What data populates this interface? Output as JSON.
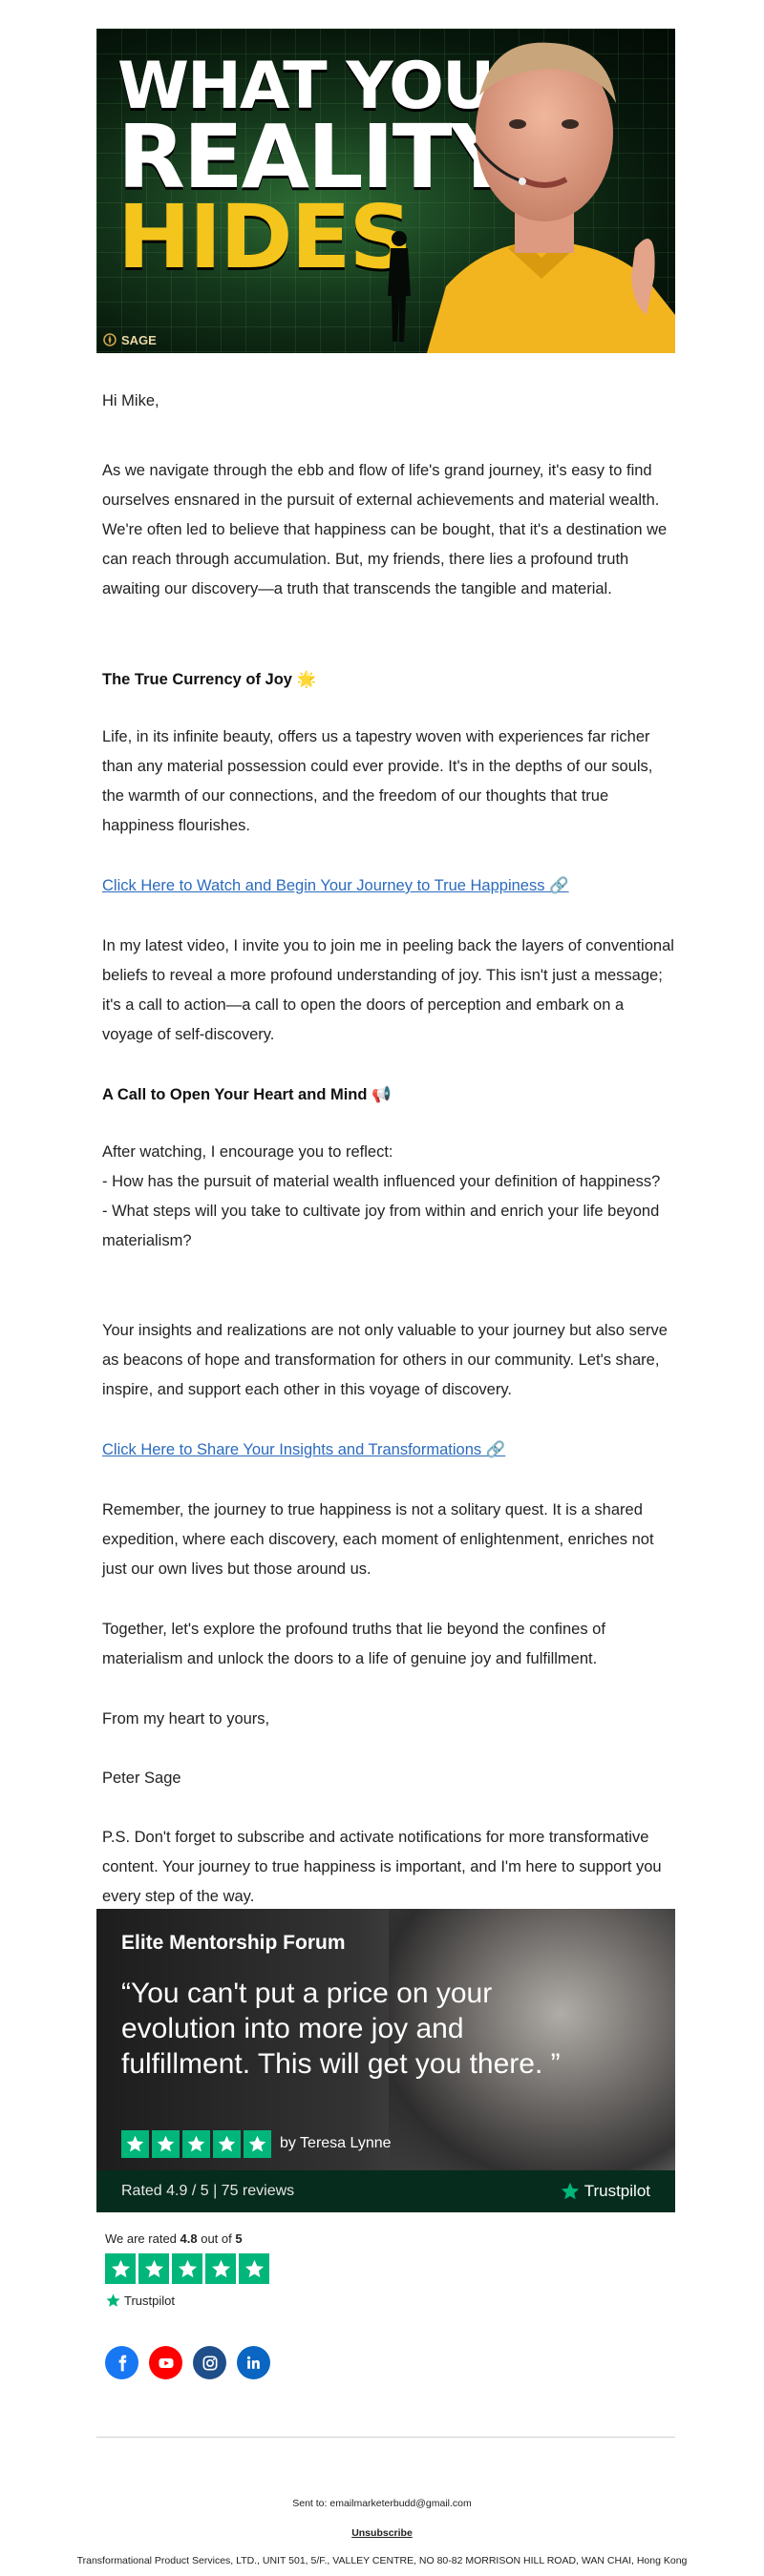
{
  "hero": {
    "line1": "WHAT YOUR",
    "line2": "REALITY",
    "line3": "HIDES",
    "logo_text": "SAGE"
  },
  "greeting": "Hi Mike,",
  "paragraphs": {
    "p1": "As we navigate through the ebb and flow of life's grand journey, it's easy to find ourselves ensnared in the pursuit of external achievements and material wealth. We're often led to believe that happiness can be bought, that it's a destination we can reach through accumulation. But, my friends, there lies a profound truth awaiting our discovery—a truth that transcends the tangible and material.",
    "h1": "The True Currency of Joy 🌟",
    "p2": "Life, in its infinite beauty, offers us a tapestry woven with experiences far richer than any material possession could ever provide. It's in the depths of our souls, the warmth of our connections, and the freedom of our thoughts that true happiness flourishes.",
    "link1": "Click Here to Watch and Begin Your Journey to True Happiness 🔗",
    "p3": "In my latest video, I invite you to join me in peeling back the layers of conventional beliefs to reveal a more profound understanding of joy. This isn't just a message; it's a call to action—a call to open the doors of perception and embark on a voyage of self-discovery.",
    "h2": "A Call to Open Your Heart and Mind 📢",
    "p4_intro": "After watching, I encourage you to reflect:",
    "p4_q1": "- How has the pursuit of material wealth influenced your definition of happiness?",
    "p4_q2": "- What steps will you take to cultivate joy from within and enrich your life beyond materialism?",
    "p5": "Your insights and realizations are not only valuable to your journey but also serve as beacons of hope and transformation for others in our community. Let's share, inspire, and support each other in this voyage of discovery.",
    "link2": "Click Here to Share Your Insights and Transformations 🔗",
    "p6": "Remember, the journey to true happiness is not a solitary quest. It is a shared expedition, where each discovery, each moment of enlightenment, enriches not just our own lives but those around us.",
    "p7": "Together, let's explore the profound truths that lie beyond the confines of materialism and unlock the doors to a life of genuine joy and fulfillment.",
    "closing": "From my heart to yours,",
    "signature": "Peter Sage",
    "ps": "P.S. Don't forget to subscribe and activate notifications for more transformative content. Your journey to true happiness is important, and I'm here to support you every step of the way."
  },
  "testimonial": {
    "forum": "Elite Mentorship Forum",
    "quote": "“You can't put a price on your evolution into more joy and fulfillment. This will get you there. ”",
    "stars": 5,
    "author": "by Teresa Lynne",
    "rated": "Rated 4.9 / 5 | 75 reviews",
    "brand": "Trustpilot"
  },
  "rating": {
    "prefix": "We are rated ",
    "score": "4.8",
    "middle": " out of ",
    "max": "5",
    "stars": 5,
    "brand": "Trustpilot"
  },
  "social": [
    "facebook-icon",
    "youtube-icon",
    "instagram-icon",
    "linkedin-icon"
  ],
  "colors": {
    "link": "#2b6bbf",
    "trustpilot_green": "#00b67a",
    "hero_yellow": "#f4c51c",
    "facebook": "#1877f2",
    "youtube": "#ff0000",
    "instagram": "#1f4f8a",
    "linkedin": "#0a66c2"
  },
  "footer": {
    "sent_to": "Sent to: emailmarketerbudd@gmail.com",
    "unsubscribe": "Unsubscribe",
    "address": "Transformational Product Services, LTD., UNIT 501, 5/F., VALLEY CENTRE, NO 80-82 MORRISON HILL ROAD, WAN CHAI, Hong Kong"
  }
}
